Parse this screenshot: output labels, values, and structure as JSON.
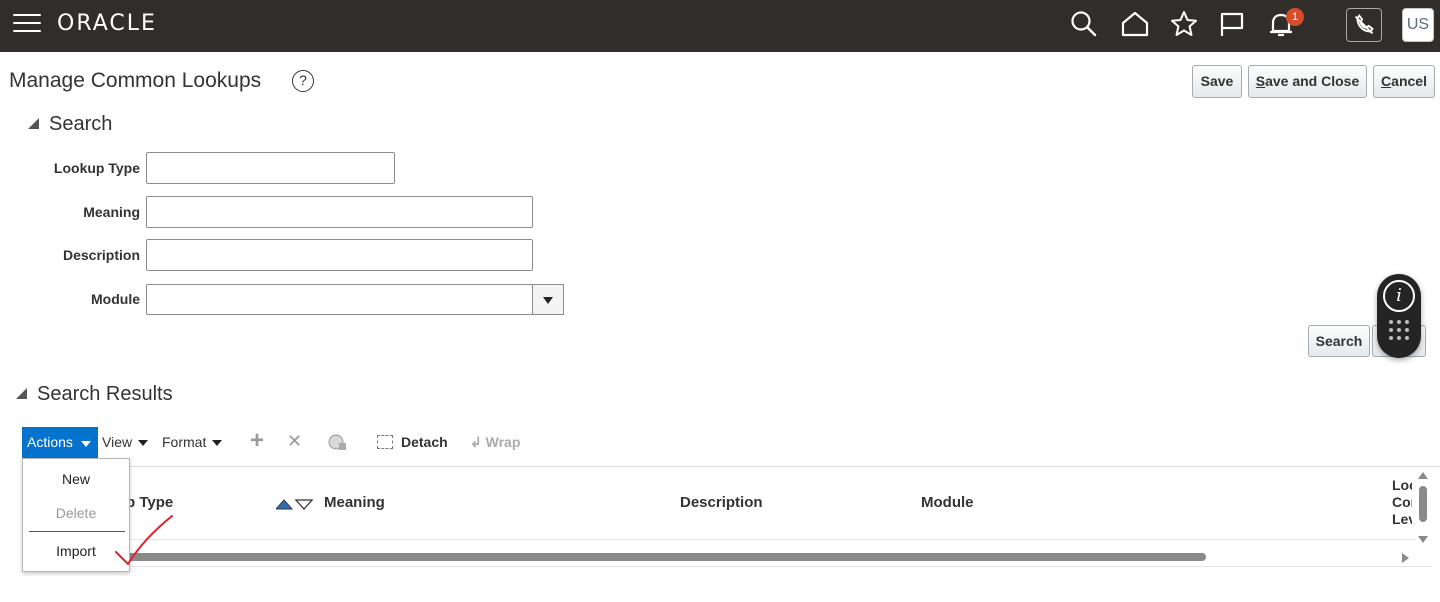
{
  "topbar": {
    "logo": "ORACLE",
    "notification_count": "1",
    "avatar_initials": "US",
    "icons": [
      "menu-icon",
      "search-icon",
      "home-icon",
      "favorites-star-icon",
      "flag-icon",
      "notifications-bell-icon",
      "phone-mute-icon"
    ]
  },
  "header": {
    "title": "Manage Common Lookups",
    "help_glyph": "?",
    "save_label": "Save",
    "save_close_prefix": "S",
    "save_close_rest": "ave and Close",
    "cancel_prefix": "C",
    "cancel_rest": "ancel"
  },
  "search": {
    "section_title": "Search",
    "fields": {
      "lookup_type_label": "Lookup Type",
      "lookup_type_value": "",
      "meaning_label": "Meaning",
      "meaning_value": "",
      "description_label": "Description",
      "description_value": "",
      "module_label": "Module",
      "module_value": ""
    },
    "search_button": "Search",
    "reset_button": ""
  },
  "info_widget": {
    "info_glyph": "i"
  },
  "results": {
    "section_title": "Search Results",
    "toolbar": {
      "actions_label": "Actions",
      "view_label": "View",
      "format_label": "Format",
      "add_glyph": "+",
      "delete_glyph": "✕",
      "detach_label": "Detach",
      "wrap_label": "Wrap"
    },
    "columns": {
      "lookup_type": "p Type",
      "meaning": "Meaning",
      "description": "Description",
      "module": "Module",
      "lookup_config_level_line1": "Loc",
      "lookup_config_level_line2": "Cor",
      "lookup_config_level_line3": "Lev"
    },
    "actions_menu": {
      "items": [
        {
          "label": "New",
          "enabled": true
        },
        {
          "label": "Delete",
          "enabled": false
        },
        {
          "label": "Import",
          "enabled": true
        }
      ]
    }
  },
  "colors": {
    "topbar_bg": "#312d2a",
    "actions_blue": "#0572ce",
    "notification_red": "#d64d2c",
    "annotation_check": "#e0202a"
  }
}
